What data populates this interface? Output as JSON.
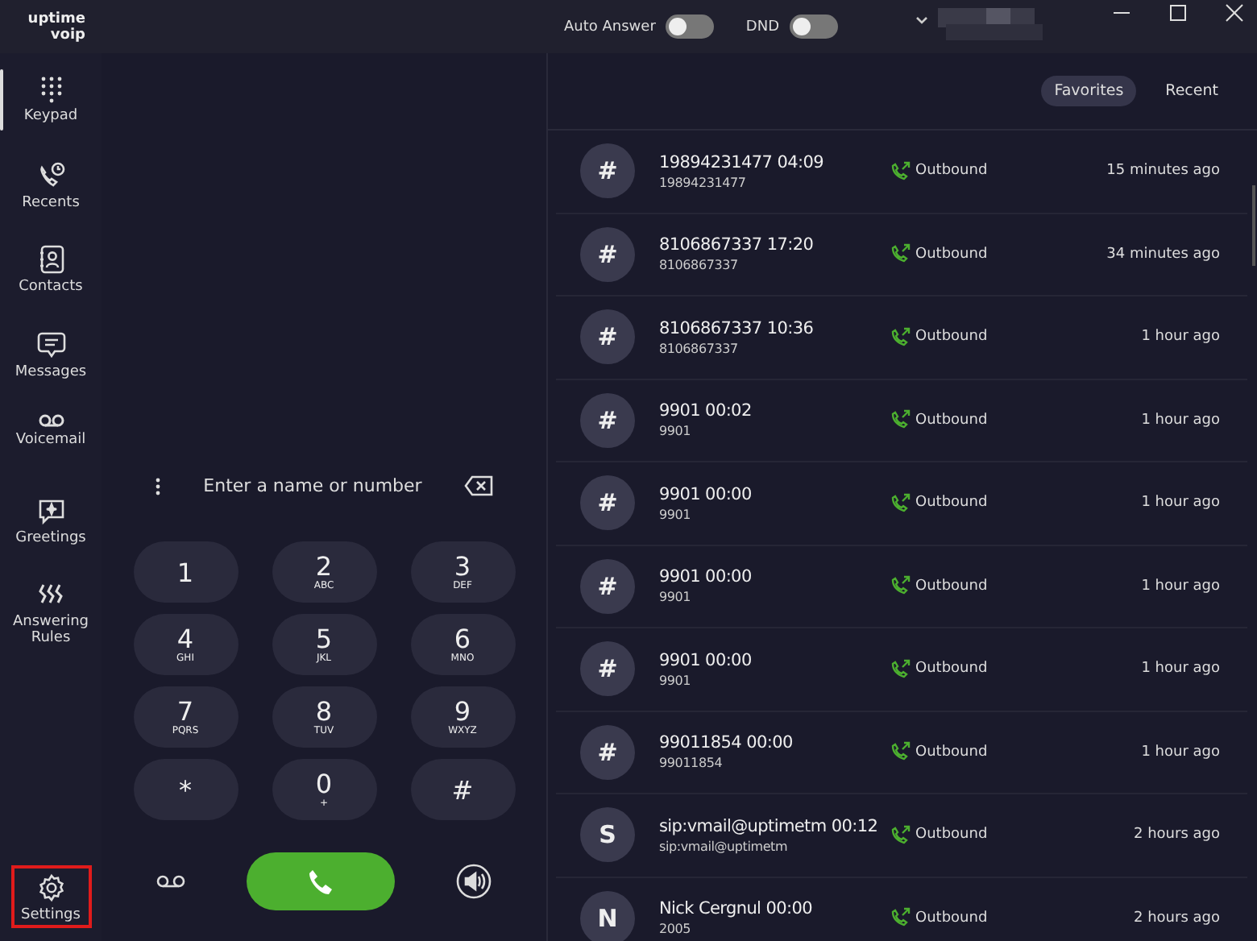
{
  "logo": {
    "line_1": "uptime",
    "line_2": "voip"
  },
  "header": {
    "toggles": [
      {
        "label": "Auto Answer",
        "on": false
      },
      {
        "label": "DND",
        "on": false
      }
    ]
  },
  "sidebar": {
    "items": [
      {
        "kind": "keypad",
        "label": "Keypad",
        "selected": true
      },
      {
        "kind": "recents",
        "label": "Recents",
        "selected": false
      },
      {
        "kind": "contacts",
        "label": "Contacts",
        "selected": false
      },
      {
        "kind": "messages",
        "label": "Messages",
        "selected": false
      },
      {
        "kind": "voicemail",
        "label": "Voicemail",
        "selected": false
      },
      {
        "kind": "greetings",
        "label": "Greetings",
        "selected": false
      },
      {
        "kind": "rules",
        "label": "Answering Rules",
        "selected": false
      }
    ],
    "settings": {
      "label": "Settings",
      "highlighted": true
    }
  },
  "dialer": {
    "placeholder": "Enter a name or number",
    "keys": [
      {
        "digit": "1"
      },
      {
        "digit": "2",
        "letters": "ABC"
      },
      {
        "digit": "3",
        "letters": "DEF"
      },
      {
        "digit": "4",
        "letters": "GHI"
      },
      {
        "digit": "5",
        "letters": "JKL"
      },
      {
        "digit": "6",
        "letters": "MNO"
      },
      {
        "digit": "7",
        "letters": "PQRS"
      },
      {
        "digit": "8",
        "letters": "TUV"
      },
      {
        "digit": "9",
        "letters": "WXYZ"
      },
      {
        "digit": "*"
      },
      {
        "digit": "0",
        "letters": "+"
      },
      {
        "digit": "#"
      }
    ]
  },
  "tabs": [
    {
      "label": "Favorites",
      "selected": true
    },
    {
      "label": "Recent",
      "selected": false
    }
  ],
  "calls": [
    {
      "avatar": "#",
      "title": "19894231477 04:09",
      "number": "19894231477",
      "direction": "Outbound",
      "time": "15 minutes ago"
    },
    {
      "avatar": "#",
      "title": "8106867337 17:20",
      "number": "8106867337",
      "direction": "Outbound",
      "time": "34 minutes ago"
    },
    {
      "avatar": "#",
      "title": "8106867337 10:36",
      "number": "8106867337",
      "direction": "Outbound",
      "time": "1 hour ago"
    },
    {
      "avatar": "#",
      "title": "9901 00:02",
      "number": "9901",
      "direction": "Outbound",
      "time": "1 hour ago"
    },
    {
      "avatar": "#",
      "title": "9901 00:00",
      "number": "9901",
      "direction": "Outbound",
      "time": "1 hour ago"
    },
    {
      "avatar": "#",
      "title": "9901 00:00",
      "number": "9901",
      "direction": "Outbound",
      "time": "1 hour ago"
    },
    {
      "avatar": "#",
      "title": "9901 00:00",
      "number": "9901",
      "direction": "Outbound",
      "time": "1 hour ago"
    },
    {
      "avatar": "#",
      "title": "99011854 00:00",
      "number": "99011854",
      "direction": "Outbound",
      "time": "1 hour ago"
    },
    {
      "avatar": "S",
      "title": "sip:vmail@uptimetm 00:12",
      "number": "sip:vmail@uptimetm",
      "direction": "Outbound",
      "time": "2 hours ago"
    },
    {
      "avatar": "N",
      "title": "Nick Cergnul 00:00",
      "number": "2005",
      "direction": "Outbound",
      "time": "2 hours ago"
    }
  ]
}
